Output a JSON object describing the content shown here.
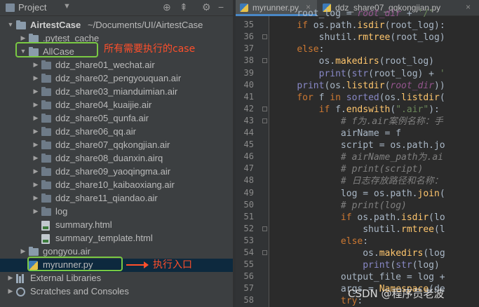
{
  "project_header": {
    "title": "Project",
    "dropdown_arrow": "▼",
    "icons": [
      "globe-icon",
      "collapse-icon",
      "gear-icon",
      "hide-icon"
    ]
  },
  "tree": [
    {
      "label": "AirtestCase",
      "path": "~/Documents/UI/AirtestCase",
      "indent": 0,
      "expanded": true,
      "type": "folder",
      "bold": true
    },
    {
      "label": ".pytest_cache",
      "indent": 1,
      "expanded": false,
      "type": "folder"
    },
    {
      "label": "AllCase",
      "indent": 1,
      "expanded": true,
      "type": "folder"
    },
    {
      "label": "ddz_share01_wechat.air",
      "indent": 2,
      "expanded": false,
      "type": "folder"
    },
    {
      "label": "ddz_share02_pengyouquan.air",
      "indent": 2,
      "expanded": false,
      "type": "folder"
    },
    {
      "label": "ddz_share03_mianduimian.air",
      "indent": 2,
      "expanded": false,
      "type": "folder"
    },
    {
      "label": "ddz_share04_kuaijie.air",
      "indent": 2,
      "expanded": false,
      "type": "folder"
    },
    {
      "label": "ddz_share05_qunfa.air",
      "indent": 2,
      "expanded": false,
      "type": "folder"
    },
    {
      "label": "ddz_share06_qq.air",
      "indent": 2,
      "expanded": false,
      "type": "folder"
    },
    {
      "label": "ddz_share07_qqkongjian.air",
      "indent": 2,
      "expanded": false,
      "type": "folder"
    },
    {
      "label": "ddz_share08_duanxin.airq",
      "indent": 2,
      "expanded": false,
      "type": "folder"
    },
    {
      "label": "ddz_share09_yaoqingma.air",
      "indent": 2,
      "expanded": false,
      "type": "folder"
    },
    {
      "label": "ddz_share10_kaibaoxiang.air",
      "indent": 2,
      "expanded": false,
      "type": "folder"
    },
    {
      "label": "ddz_share11_qiandao.air",
      "indent": 2,
      "expanded": false,
      "type": "folder"
    },
    {
      "label": "log",
      "indent": 2,
      "expanded": false,
      "type": "folder"
    },
    {
      "label": "summary.html",
      "indent": 2,
      "type": "html"
    },
    {
      "label": "summary_template.html",
      "indent": 2,
      "type": "html"
    },
    {
      "label": "gongyou.air",
      "indent": 1,
      "expanded": false,
      "type": "folder"
    },
    {
      "label": "myrunner.py",
      "indent": 1,
      "type": "py",
      "selected": true
    },
    {
      "label": "External Libraries",
      "indent": 0,
      "expanded": false,
      "type": "lib"
    },
    {
      "label": "Scratches and Consoles",
      "indent": 0,
      "expanded": false,
      "type": "scratch"
    }
  ],
  "annotations": {
    "allcase_note": "所有需要执行的case",
    "entry_note": "执行入口"
  },
  "tabs": [
    {
      "label": "myrunner.py",
      "active": true
    },
    {
      "label": "ddz_share07_qqkongjian.py",
      "active": false
    }
  ],
  "line_numbers": [
    "35",
    "36",
    "37",
    "38",
    "39",
    "40",
    "41",
    "42",
    "43",
    "44",
    "45",
    "46",
    "47",
    "48",
    "49",
    "50",
    "51",
    "52",
    "53",
    "54",
    "55",
    "56",
    "57",
    "58"
  ],
  "code_lines": [
    "    root_log = root_dir + '/'",
    "    if os.path.isdir(root_log):",
    "        shutil.rmtree(root_log)",
    "    else:",
    "        os.makedirs(root_log)",
    "        print(str(root_log) + '",
    "    print(os.listdir(root_dir))",
    "    for f in sorted(os.listdir(",
    "        if f.endswith(\".air\"):",
    "            # f为.air案例名称：手",
    "            airName = f",
    "            script = os.path.jo",
    "            # airName_path为.ai",
    "            # print(script)",
    "            # 日志存放路径和名称：",
    "            log = os.path.join(",
    "            # print(log)",
    "            if os.path.isdir(lo",
    "                shutil.rmtree(l",
    "            else:",
    "                os.makedirs(log",
    "                print(str(log)",
    "            output_file = log +",
    "            args = Namespace(de",
    "            try:"
  ],
  "watermark": "CSDN @程序员老波",
  "colors": {
    "panel_bg": "#3c3f41",
    "editor_bg": "#2b2b2b",
    "selection": "#0d293e",
    "annotation_red": "#ff4f2b",
    "annotation_green": "#7ac943",
    "tab_underline": "#4a88c7"
  }
}
